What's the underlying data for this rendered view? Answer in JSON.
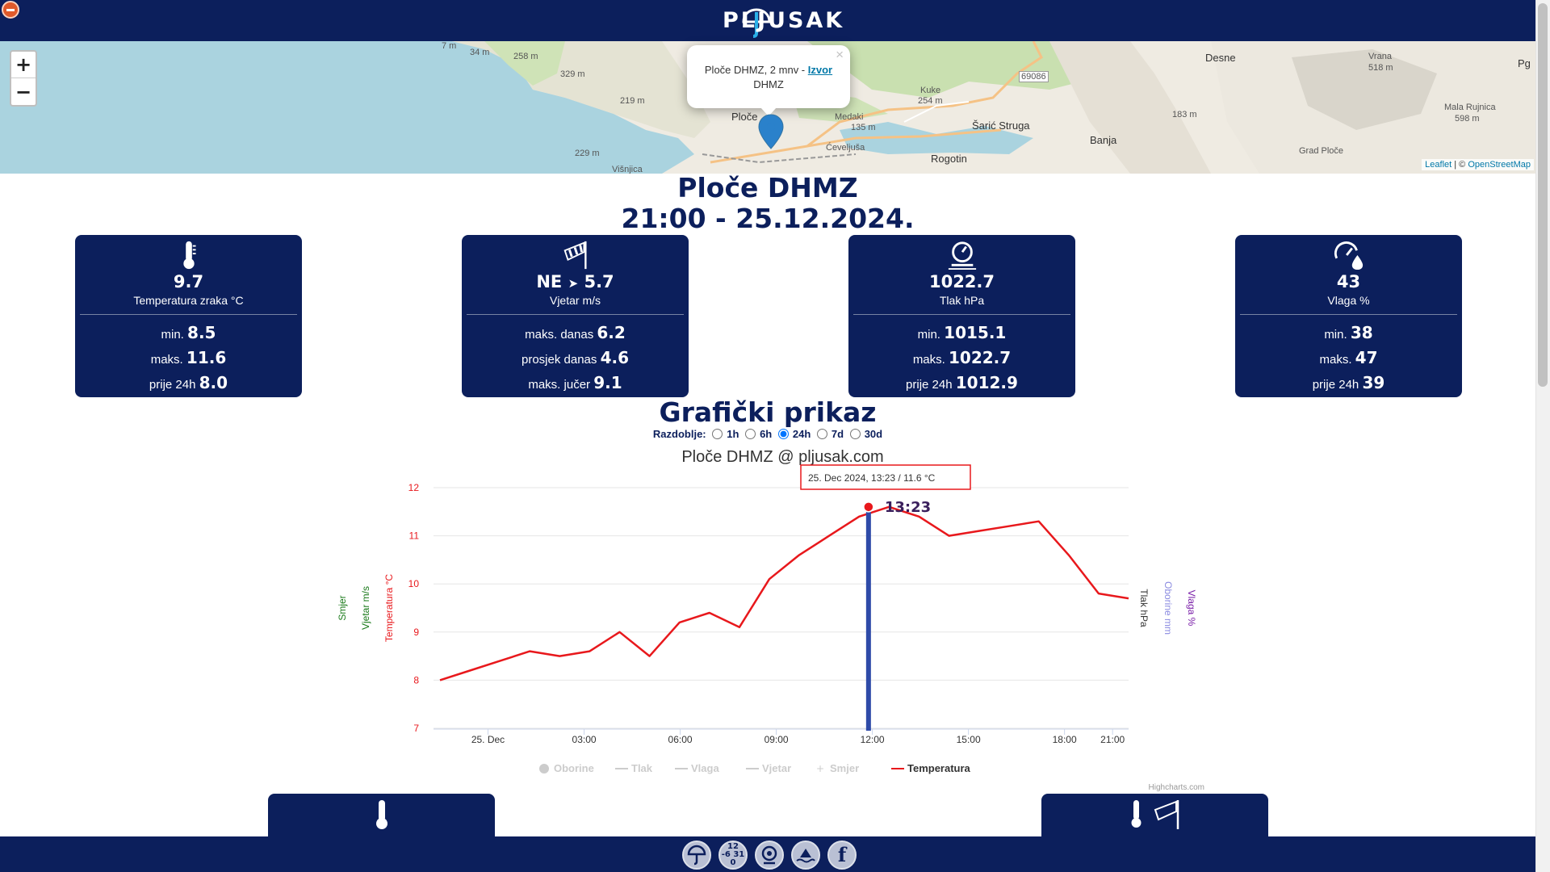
{
  "app": {
    "logo_text": "PLJUSAK"
  },
  "map": {
    "zoom_in": "+",
    "zoom_out": "−",
    "popup": {
      "text": "Ploče DHMZ, 2 mnv - ",
      "link": "Izvor",
      "line2": "DHMZ",
      "close": "×"
    },
    "attribution": {
      "leaflet": "Leaflet",
      "sep": " | © ",
      "osm": "OpenStreetMap"
    },
    "labels": [
      "7 m",
      "34 m",
      "258 m",
      "329 m",
      "219 m",
      "229 m",
      "Ploče",
      "Višnjica",
      "Kuke",
      "254 m",
      "Medaki",
      "135 m",
      "Ćeveljuša",
      "Šarić Struga",
      "Rogotin",
      "Banja",
      "183 m",
      "Desne",
      "Vrana",
      "518 m",
      "Mala Rujnica",
      "598 m",
      "Grad Ploče",
      "69086",
      "Pg"
    ]
  },
  "station": {
    "name": "Ploče DHMZ",
    "datetime": "21:00 - 25.12.2024."
  },
  "cards": {
    "temperature": {
      "value": "9.7",
      "label": "Temperatura zraka °C",
      "min_label": "min.",
      "min": "8.5",
      "max_label": "maks.",
      "max": "11.6",
      "prev_label": "prije 24h",
      "prev": "8.0"
    },
    "wind": {
      "dir": "NE",
      "value": "5.7",
      "label": "Vjetar m/s",
      "max_label": "maks. danas",
      "max": "6.2",
      "avg_label": "prosjek danas",
      "avg": "4.6",
      "yday_label": "maks. jučer",
      "yday": "9.1"
    },
    "pressure": {
      "value": "1022.7",
      "label": "Tlak hPa",
      "min_label": "min.",
      "min": "1015.1",
      "max_label": "maks.",
      "max": "1022.7",
      "prev_label": "prije 24h",
      "prev": "1012.9"
    },
    "humidity": {
      "value": "43",
      "label": "Vlaga %",
      "min_label": "min.",
      "min": "38",
      "max_label": "maks.",
      "max": "47",
      "prev_label": "prije 24h",
      "prev": "39"
    }
  },
  "graph": {
    "heading": "Grafički prikaz",
    "period_label": "Razdoblje:",
    "periods": [
      "1h",
      "6h",
      "24h",
      "7d",
      "30d"
    ],
    "selected_period": "24h"
  },
  "chart_data": {
    "type": "line",
    "title": "Ploče DHMZ @ pljusak.com",
    "x_ticks": [
      "25. Dec",
      "03:00",
      "06:00",
      "09:00",
      "12:00",
      "15:00",
      "18:00",
      "21:00"
    ],
    "y_ticks": [
      7,
      8,
      9,
      10,
      11,
      12
    ],
    "ylim": [
      7,
      12
    ],
    "axis_titles_left": [
      "Smjer",
      "Vjetar m/s",
      "Temperatura °C"
    ],
    "axis_titles_right": [
      "Tlak hPa",
      "Oborine mm",
      "Vlaga %"
    ],
    "series": [
      {
        "name": "Temperatura",
        "color": "#e8181c",
        "x_hours": [
          0,
          1,
          2,
          3,
          4,
          5,
          6,
          7,
          8,
          9,
          10,
          11,
          12,
          13,
          14,
          15,
          16,
          17,
          18,
          19,
          20,
          21
        ],
        "values": [
          8.0,
          8.2,
          8.4,
          8.6,
          8.5,
          8.6,
          9.0,
          8.5,
          9.2,
          9.4,
          9.1,
          10.1,
          10.6,
          11.0,
          11.4,
          11.6,
          11.4,
          11.0,
          11.1,
          11.2,
          11.3,
          10.6,
          9.8,
          9.7
        ]
      }
    ],
    "legend": [
      "Oborine",
      "Tlak",
      "Vlaga",
      "Vjetar",
      "Smjer",
      "Temperatura"
    ],
    "tooltip": "25. Dec 2024, 13:23 / 11.6 °C",
    "crosshair_label": "13:23",
    "credits": "Highcharts.com"
  },
  "colors": {
    "navy": "#0c1f5c",
    "temperature": "#e8181c",
    "crosshair": "#2e4aa8"
  }
}
